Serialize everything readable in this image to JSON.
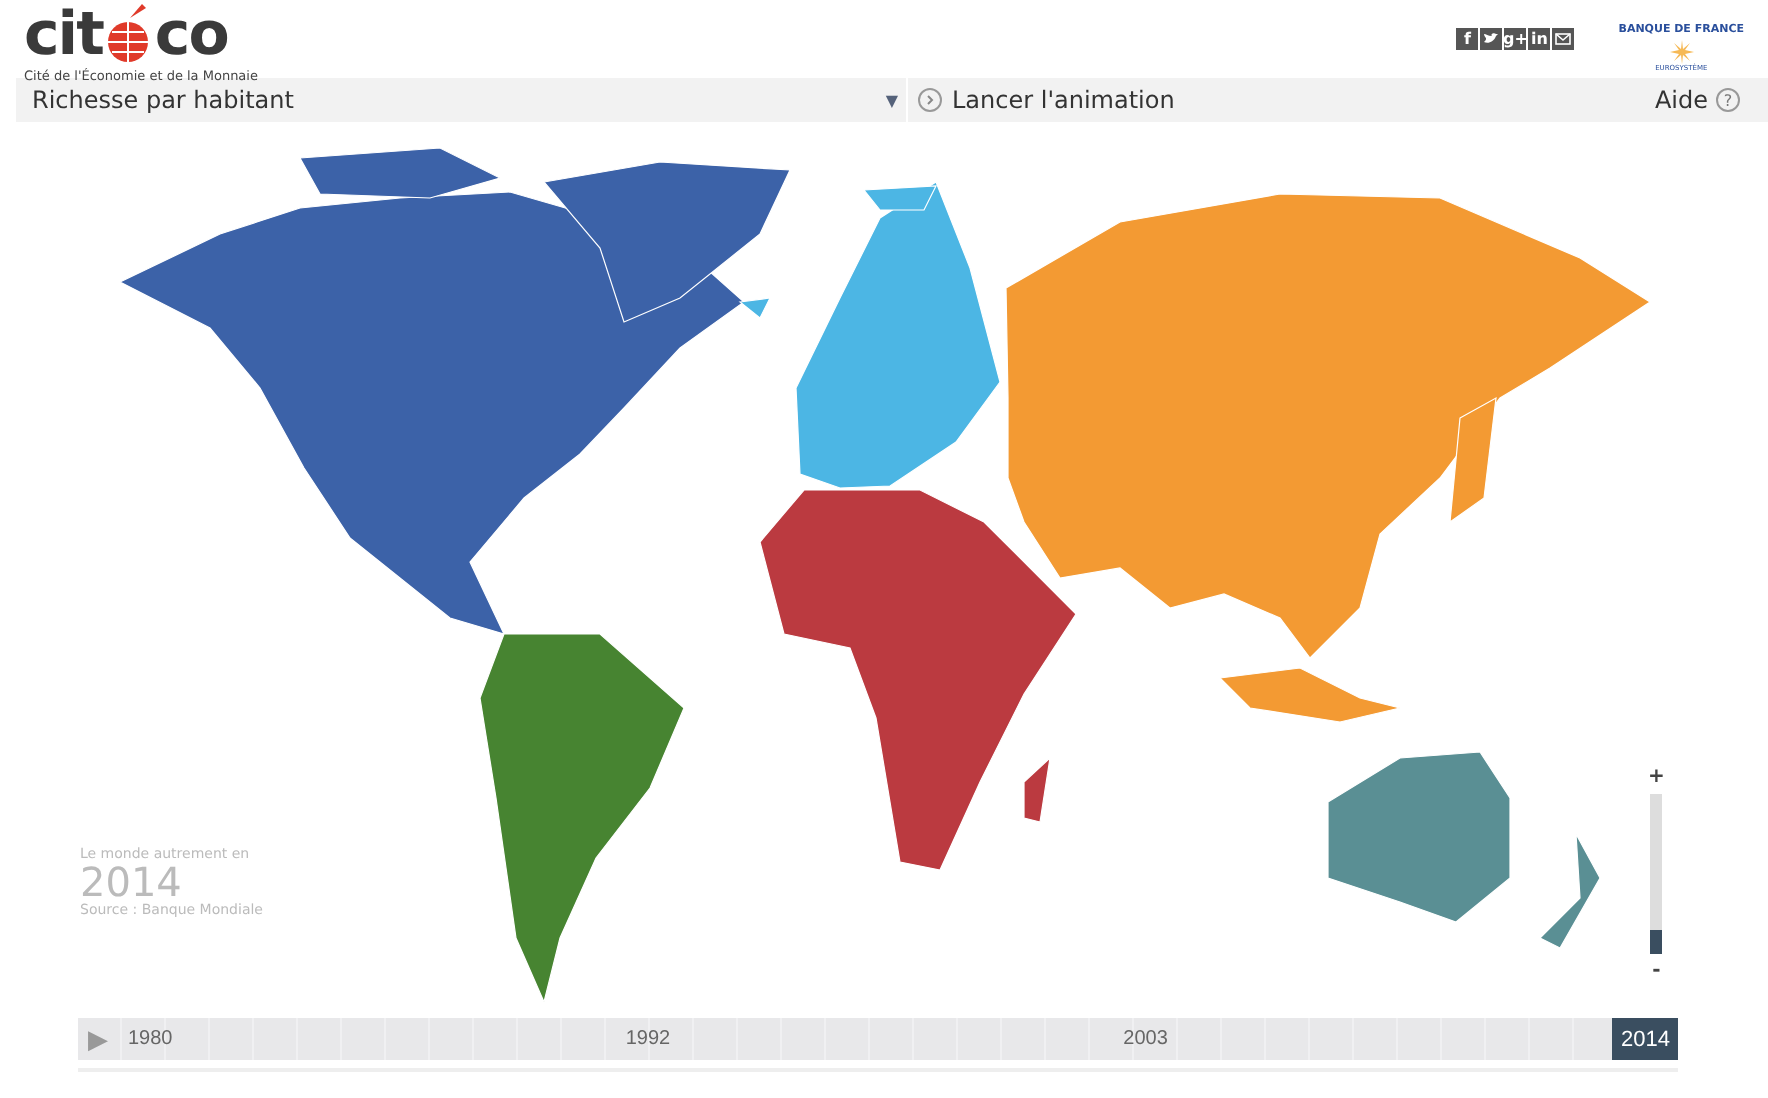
{
  "header": {
    "logo": {
      "before": "cit",
      "after": "co",
      "tagline": "Cité de l'Économie et de la Monnaie"
    },
    "social": [
      {
        "kind": "text",
        "label": "f"
      },
      {
        "kind": "bird"
      },
      {
        "kind": "text",
        "label": "g+"
      },
      {
        "kind": "text",
        "label": "in"
      },
      {
        "kind": "mail"
      }
    ],
    "partner": {
      "name": "BANQUE DE FRANCE",
      "sub": "EUROSYSTÈME"
    }
  },
  "toolbar": {
    "dropdown": "Richesse par habitant",
    "caret": "▼",
    "animate": "Lancer l'animation",
    "help": "Aide",
    "help_icon": "?"
  },
  "map": {
    "regions": [
      {
        "kind": "north-america",
        "color": "#3c62a8"
      },
      {
        "kind": "south-america",
        "color": "#478431"
      },
      {
        "kind": "europe",
        "color": "#4cb6e4"
      },
      {
        "kind": "africa",
        "color": "#bb3a40"
      },
      {
        "kind": "asia",
        "color": "#f39a33"
      },
      {
        "kind": "oceania",
        "color": "#5a8f94"
      }
    ],
    "caption": {
      "intro": "Le monde autrement en",
      "year": "2014",
      "source": "Source : Banque Mondiale"
    },
    "zoom": {
      "plus": "+",
      "minus": "-",
      "level": 0.15
    }
  },
  "timeline": {
    "play": "▶",
    "labels": [
      {
        "label": "1980",
        "selected": false
      },
      {
        "label": "1992",
        "selected": false
      },
      {
        "label": "2003",
        "selected": false
      },
      {
        "label": "2014",
        "selected": true
      }
    ]
  }
}
